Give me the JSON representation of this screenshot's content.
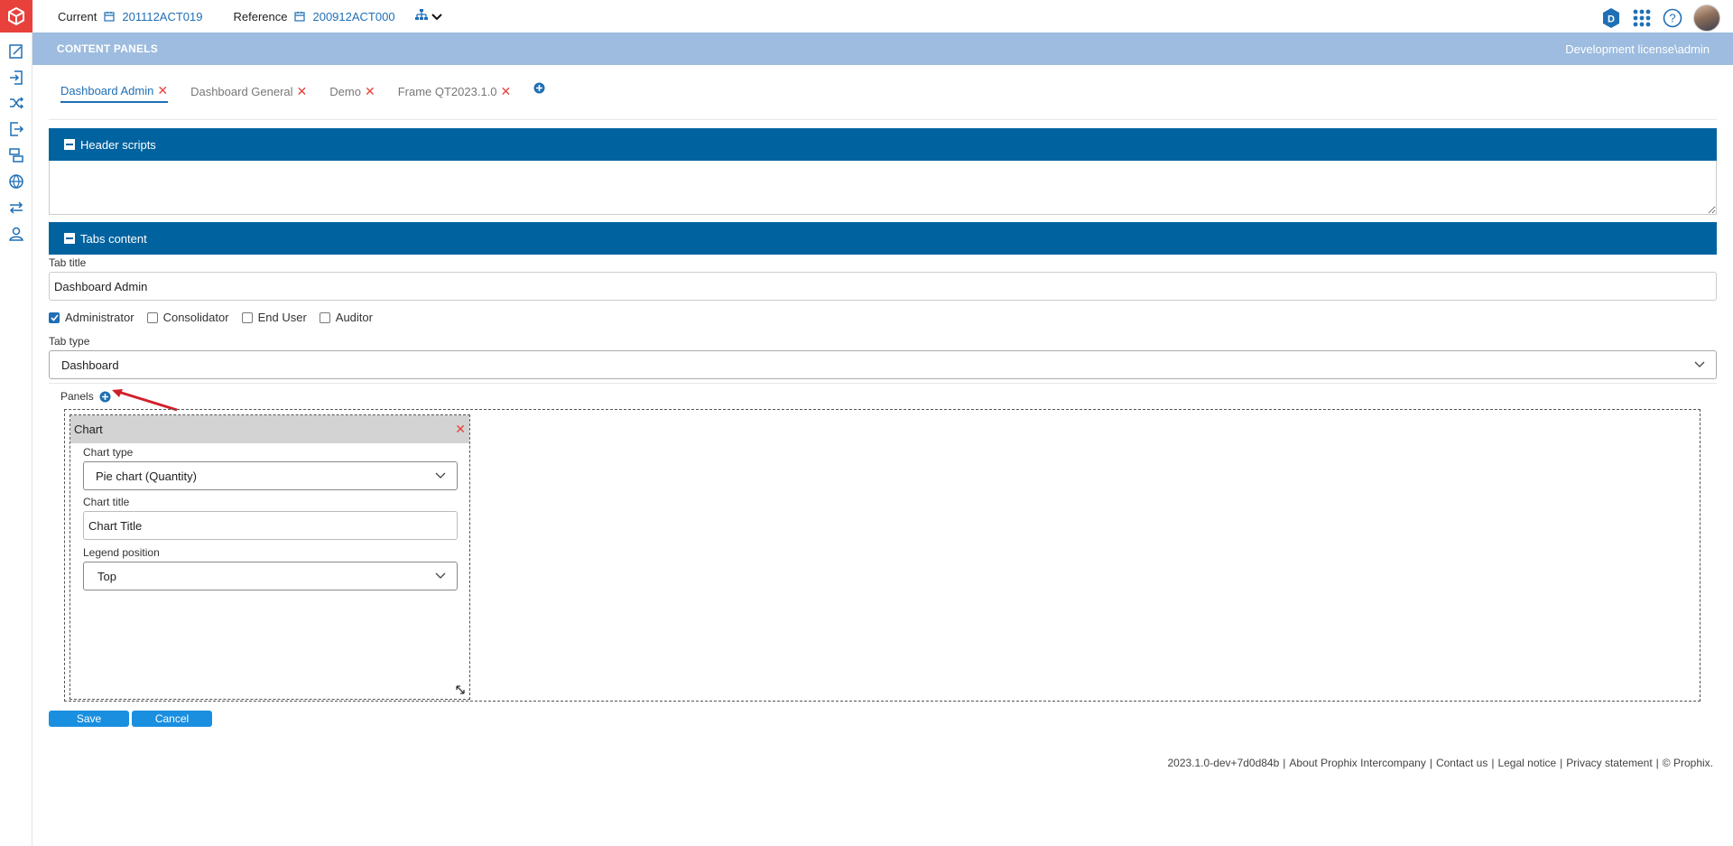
{
  "topbar": {
    "current_label": "Current",
    "current_value": "201112ACT019",
    "reference_label": "Reference",
    "reference_value": "200912ACT000",
    "hierarchy_icon": "org-chart-icon",
    "right_icons": [
      "d-hexagon-icon",
      "apps-grid-icon",
      "help-icon",
      "user-avatar"
    ]
  },
  "band": {
    "title": "CONTENT PANELS",
    "license": "Development license\\admin"
  },
  "tabs": [
    {
      "label": "Dashboard Admin",
      "active": true
    },
    {
      "label": "Dashboard General",
      "active": false
    },
    {
      "label": "Demo",
      "active": false
    },
    {
      "label": "Frame QT2023.1.0",
      "active": false
    }
  ],
  "tab_close_glyph": "✕",
  "header_scripts": {
    "title": "Header scripts",
    "value": ""
  },
  "tabs_content": {
    "title": "Tabs content",
    "tab_title_label": "Tab title",
    "tab_title_value": "Dashboard Admin",
    "roles": [
      {
        "label": "Administrator",
        "checked": true
      },
      {
        "label": "Consolidator",
        "checked": false
      },
      {
        "label": "End User",
        "checked": false
      },
      {
        "label": "Auditor",
        "checked": false
      }
    ],
    "tab_type_label": "Tab type",
    "tab_type_value": "Dashboard",
    "panels_label": "Panels"
  },
  "panel": {
    "title": "Chart",
    "close_glyph": "✕",
    "chart_type_label": "Chart type",
    "chart_type_value": "Pie chart (Quantity)",
    "chart_title_label": "Chart title",
    "chart_title_value": "Chart Title",
    "legend_position_label": "Legend position",
    "legend_position_value": "Top"
  },
  "buttons": {
    "save": "Save",
    "cancel": "Cancel"
  },
  "footer": {
    "version": "2023.1.0-dev+7d0d84b",
    "links": [
      "About Prophix Intercompany",
      "Contact us",
      "Legal notice",
      "Privacy statement",
      "© Prophix."
    ]
  },
  "colors": {
    "accent": "#0063a0",
    "band": "#9dbcdf",
    "link": "#1f6fb5",
    "close": "#e8413c",
    "button": "#1a8fe0"
  }
}
